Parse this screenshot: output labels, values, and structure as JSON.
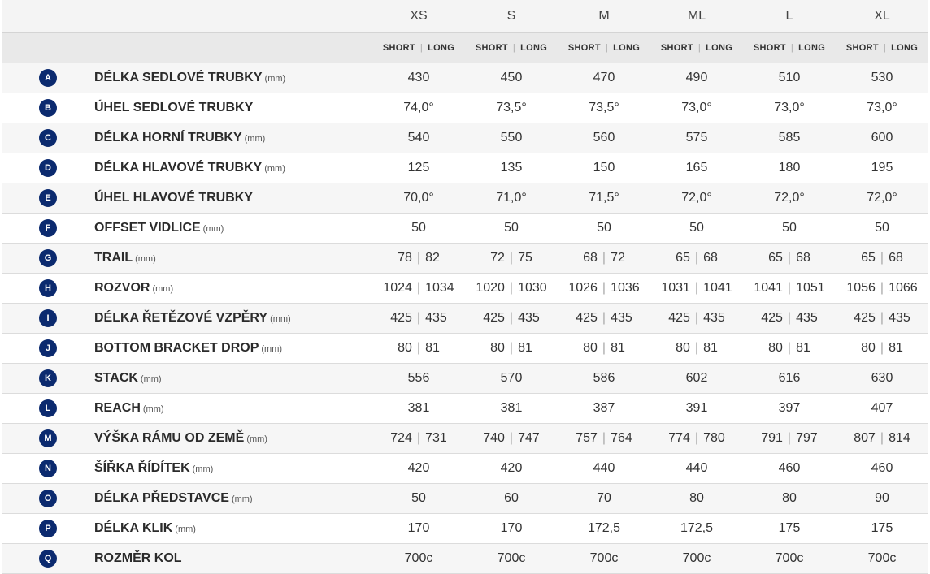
{
  "sizes": [
    "XS",
    "S",
    "M",
    "ML",
    "L",
    "XL"
  ],
  "short_label": "SHORT",
  "long_label": "LONG",
  "rows": [
    {
      "letter": "A",
      "name": "DÉLKA SEDLOVÉ TRUBKY",
      "unit": "(mm)",
      "values": [
        "430",
        "450",
        "470",
        "490",
        "510",
        "530"
      ]
    },
    {
      "letter": "B",
      "name": "ÚHEL SEDLOVÉ TRUBKY",
      "unit": "",
      "values": [
        "74,0°",
        "73,5°",
        "73,5°",
        "73,0°",
        "73,0°",
        "73,0°"
      ]
    },
    {
      "letter": "C",
      "name": "DÉLKA HORNÍ TRUBKY",
      "unit": "(mm)",
      "values": [
        "540",
        "550",
        "560",
        "575",
        "585",
        "600"
      ]
    },
    {
      "letter": "D",
      "name": "DÉLKA HLAVOVÉ TRUBKY",
      "unit": "(mm)",
      "values": [
        "125",
        "135",
        "150",
        "165",
        "180",
        "195"
      ]
    },
    {
      "letter": "E",
      "name": "ÚHEL HLAVOVÉ TRUBKY",
      "unit": "",
      "values": [
        "70,0°",
        "71,0°",
        "71,5°",
        "72,0°",
        "72,0°",
        "72,0°"
      ]
    },
    {
      "letter": "F",
      "name": "OFFSET VIDLICE",
      "unit": "(mm)",
      "values": [
        "50",
        "50",
        "50",
        "50",
        "50",
        "50"
      ]
    },
    {
      "letter": "G",
      "name": "TRAIL",
      "unit": "(mm)",
      "values": [
        [
          "78",
          "82"
        ],
        [
          "72",
          "75"
        ],
        [
          "68",
          "72"
        ],
        [
          "65",
          "68"
        ],
        [
          "65",
          "68"
        ],
        [
          "65",
          "68"
        ]
      ]
    },
    {
      "letter": "H",
      "name": "ROZVOR",
      "unit": "(mm)",
      "values": [
        [
          "1024",
          "1034"
        ],
        [
          "1020",
          "1030"
        ],
        [
          "1026",
          "1036"
        ],
        [
          "1031",
          "1041"
        ],
        [
          "1041",
          "1051"
        ],
        [
          "1056",
          "1066"
        ]
      ]
    },
    {
      "letter": "I",
      "name": "DÉLKA ŘETĚZOVÉ VZPĚRY",
      "unit": "(mm)",
      "values": [
        [
          "425",
          "435"
        ],
        [
          "425",
          "435"
        ],
        [
          "425",
          "435"
        ],
        [
          "425",
          "435"
        ],
        [
          "425",
          "435"
        ],
        [
          "425",
          "435"
        ]
      ]
    },
    {
      "letter": "J",
      "name": "BOTTOM BRACKET DROP",
      "unit": "(mm)",
      "values": [
        [
          "80",
          "81"
        ],
        [
          "80",
          "81"
        ],
        [
          "80",
          "81"
        ],
        [
          "80",
          "81"
        ],
        [
          "80",
          "81"
        ],
        [
          "80",
          "81"
        ]
      ]
    },
    {
      "letter": "K",
      "name": "STACK",
      "unit": "(mm)",
      "values": [
        "556",
        "570",
        "586",
        "602",
        "616",
        "630"
      ]
    },
    {
      "letter": "L",
      "name": "REACH",
      "unit": "(mm)",
      "values": [
        "381",
        "381",
        "387",
        "391",
        "397",
        "407"
      ]
    },
    {
      "letter": "M",
      "name": "VÝŠKA RÁMU OD ZEMĚ",
      "unit": "(mm)",
      "values": [
        [
          "724",
          "731"
        ],
        [
          "740",
          "747"
        ],
        [
          "757",
          "764"
        ],
        [
          "774",
          "780"
        ],
        [
          "791",
          "797"
        ],
        [
          "807",
          "814"
        ]
      ]
    },
    {
      "letter": "N",
      "name": "ŠÍŘKA ŘÍDÍTEK",
      "unit": "(mm)",
      "values": [
        "420",
        "420",
        "440",
        "440",
        "460",
        "460"
      ]
    },
    {
      "letter": "O",
      "name": "DÉLKA PŘEDSTAVCE",
      "unit": "(mm)",
      "values": [
        "50",
        "60",
        "70",
        "80",
        "80",
        "90"
      ]
    },
    {
      "letter": "P",
      "name": "DÉLKA KLIK",
      "unit": "(mm)",
      "values": [
        "170",
        "170",
        "172,5",
        "172,5",
        "175",
        "175"
      ]
    },
    {
      "letter": "Q",
      "name": "ROZMĚR KOL",
      "unit": "",
      "values": [
        "700c",
        "700c",
        "700c",
        "700c",
        "700c",
        "700c"
      ]
    }
  ],
  "colors": {
    "badge": "#0b2a6f",
    "header_bg": "#e9e9e9",
    "row_alt": "#f6f6f6"
  }
}
